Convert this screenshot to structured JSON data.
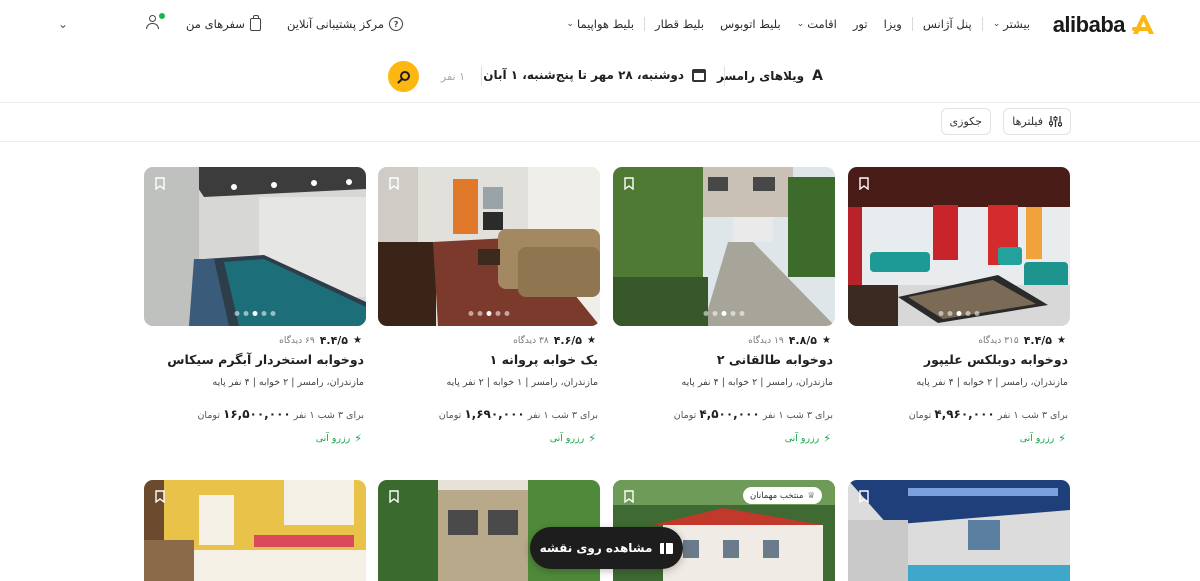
{
  "header": {
    "logo_text": "alibaba",
    "nav": [
      {
        "label": "بلیط هواپیما",
        "dropdown": true
      },
      {
        "label": "بلیط قطار",
        "dropdown": false
      },
      {
        "label": "بلیط اتوبوس",
        "dropdown": false
      },
      {
        "label": "اقامت",
        "dropdown": true
      },
      {
        "label": "تور",
        "dropdown": false
      },
      {
        "label": "ویزا",
        "dropdown": false
      },
      {
        "label": "پنل آژانس",
        "dropdown": false
      },
      {
        "label": "بیشتر",
        "dropdown": true
      }
    ],
    "support_label": "مرکز پشتیبانی آنلاین",
    "trips_label": "سفرهای من"
  },
  "search": {
    "destination": "ویلاهای رامسر",
    "dates": "دوشنبه، ۲۸ مهر تا پنج‌شنبه، ۱ آبان",
    "guests": "۱ نفر"
  },
  "filters": {
    "filters_label": "فیلترها",
    "jacuzzi_label": "جکوزی"
  },
  "listings": [
    {
      "score": "۴.۴/۵",
      "reviews": "۳۱۵ دیدگاه",
      "title": "دوخوابه دوبلکس علیپور",
      "location": "مازندران، رامسر",
      "bedrooms": "۲ خوابه",
      "capacity": "۴ نفر پایه",
      "price_prefix": "برای ۳ شب ۱ نفر",
      "price": "۴,۹۶۰,۰۰۰",
      "currency": "تومان",
      "instant": "رزرو آنی"
    },
    {
      "score": "۴.۸/۵",
      "reviews": "۱۹ دیدگاه",
      "title": "دوخوابه طالقانی ۲",
      "location": "مازندران، رامسر",
      "bedrooms": "۲ خوابه",
      "capacity": "۴ نفر پایه",
      "price_prefix": "برای ۳ شب ۱ نفر",
      "price": "۴,۵۰۰,۰۰۰",
      "currency": "تومان",
      "instant": "رزرو آنی"
    },
    {
      "score": "۴.۶/۵",
      "reviews": "۳۸ دیدگاه",
      "title": "یک خوابه پروانه ۱",
      "location": "مازندران، رامسر",
      "bedrooms": "۱ خوابه",
      "capacity": "۲ نفر پایه",
      "price_prefix": "برای ۳ شب ۱ نفر",
      "price": "۱,۶۹۰,۰۰۰",
      "currency": "تومان",
      "instant": "رزرو آنی"
    },
    {
      "score": "۴.۴/۵",
      "reviews": "۶۹ دیدگاه",
      "title": "دوخوابه استخردار آبگرم سیکاس",
      "location": "مازندران، رامسر",
      "bedrooms": "۲ خوابه",
      "capacity": "۴ نفر پایه",
      "price_prefix": "برای ۳ شب ۱ نفر",
      "price": "۱۶,۵۰۰,۰۰۰",
      "currency": "تومان",
      "instant": "رزرو آنی"
    }
  ],
  "second_row": {
    "host_pick_badge": "منتخب مهمانان"
  },
  "map_button_label": "مشاهده روی نقشه"
}
